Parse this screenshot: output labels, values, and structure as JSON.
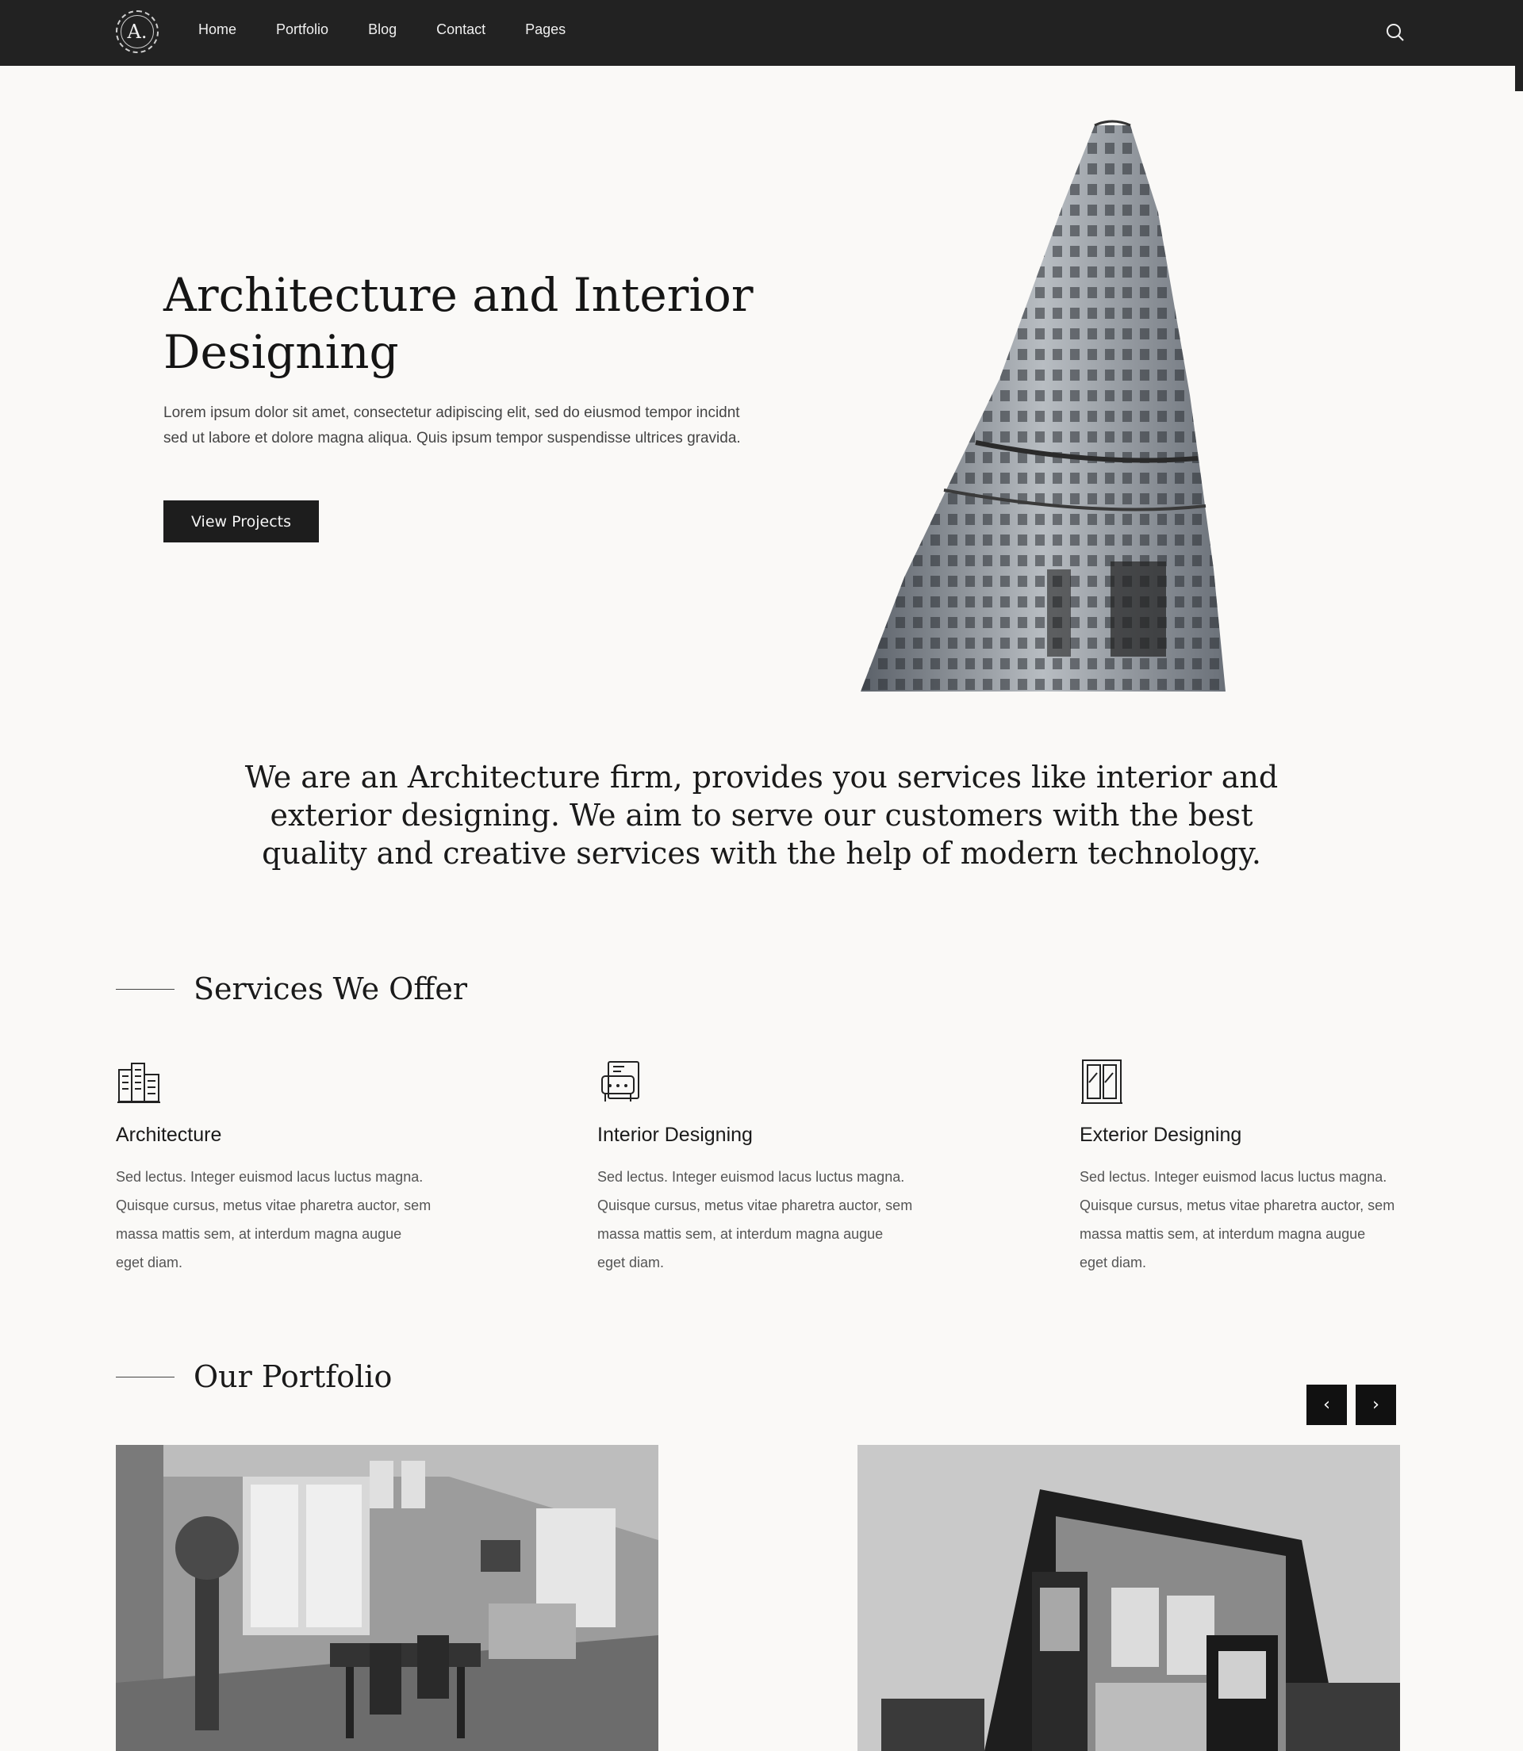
{
  "nav": {
    "logo_text": "A.",
    "items": [
      {
        "label": "Home"
      },
      {
        "label": "Portfolio"
      },
      {
        "label": "Blog"
      },
      {
        "label": "Contact"
      },
      {
        "label": "Pages"
      }
    ],
    "search_icon": "search-icon"
  },
  "hero": {
    "title": "Architecture and Interior Designing",
    "text": "Lorem ipsum dolor sit amet, consectetur adipiscing elit, sed do eiusmod tempor incidnt sed ut labore et dolore magna aliqua. Quis ipsum tempor suspendisse ultrices gravida.",
    "button_label": "View Projects"
  },
  "intro": {
    "text": "We are an Architecture firm, provides you services like interior and exterior designing. We aim to serve our customers with the best quality and creative services with the help of modern technology."
  },
  "services": {
    "heading": "Services We Offer",
    "items": [
      {
        "icon": "buildings-icon",
        "title": "Architecture",
        "text": "Sed lectus. Integer euismod lacus luctus magna. Quisque cursus, metus vitae pharetra auctor, sem massa mattis sem, at interdum magna augue eget diam."
      },
      {
        "icon": "armchair-icon",
        "title": "Interior Designing",
        "text": "Sed lectus. Integer euismod lacus luctus magna. Quisque cursus, metus vitae pharetra auctor, sem massa mattis sem, at interdum magna augue eget diam."
      },
      {
        "icon": "window-icon",
        "title": "Exterior Designing",
        "text": "Sed lectus. Integer euismod lacus luctus magna. Quisque cursus, metus vitae pharetra auctor, sem massa mattis sem, at interdum magna augue eget diam."
      }
    ]
  },
  "portfolio": {
    "heading": "Our Portfolio",
    "prev_label": "‹",
    "next_label": "›"
  },
  "colors": {
    "nav_bg": "#222222",
    "page_bg": "#faf9f7",
    "button_bg": "#1d1d1d"
  }
}
